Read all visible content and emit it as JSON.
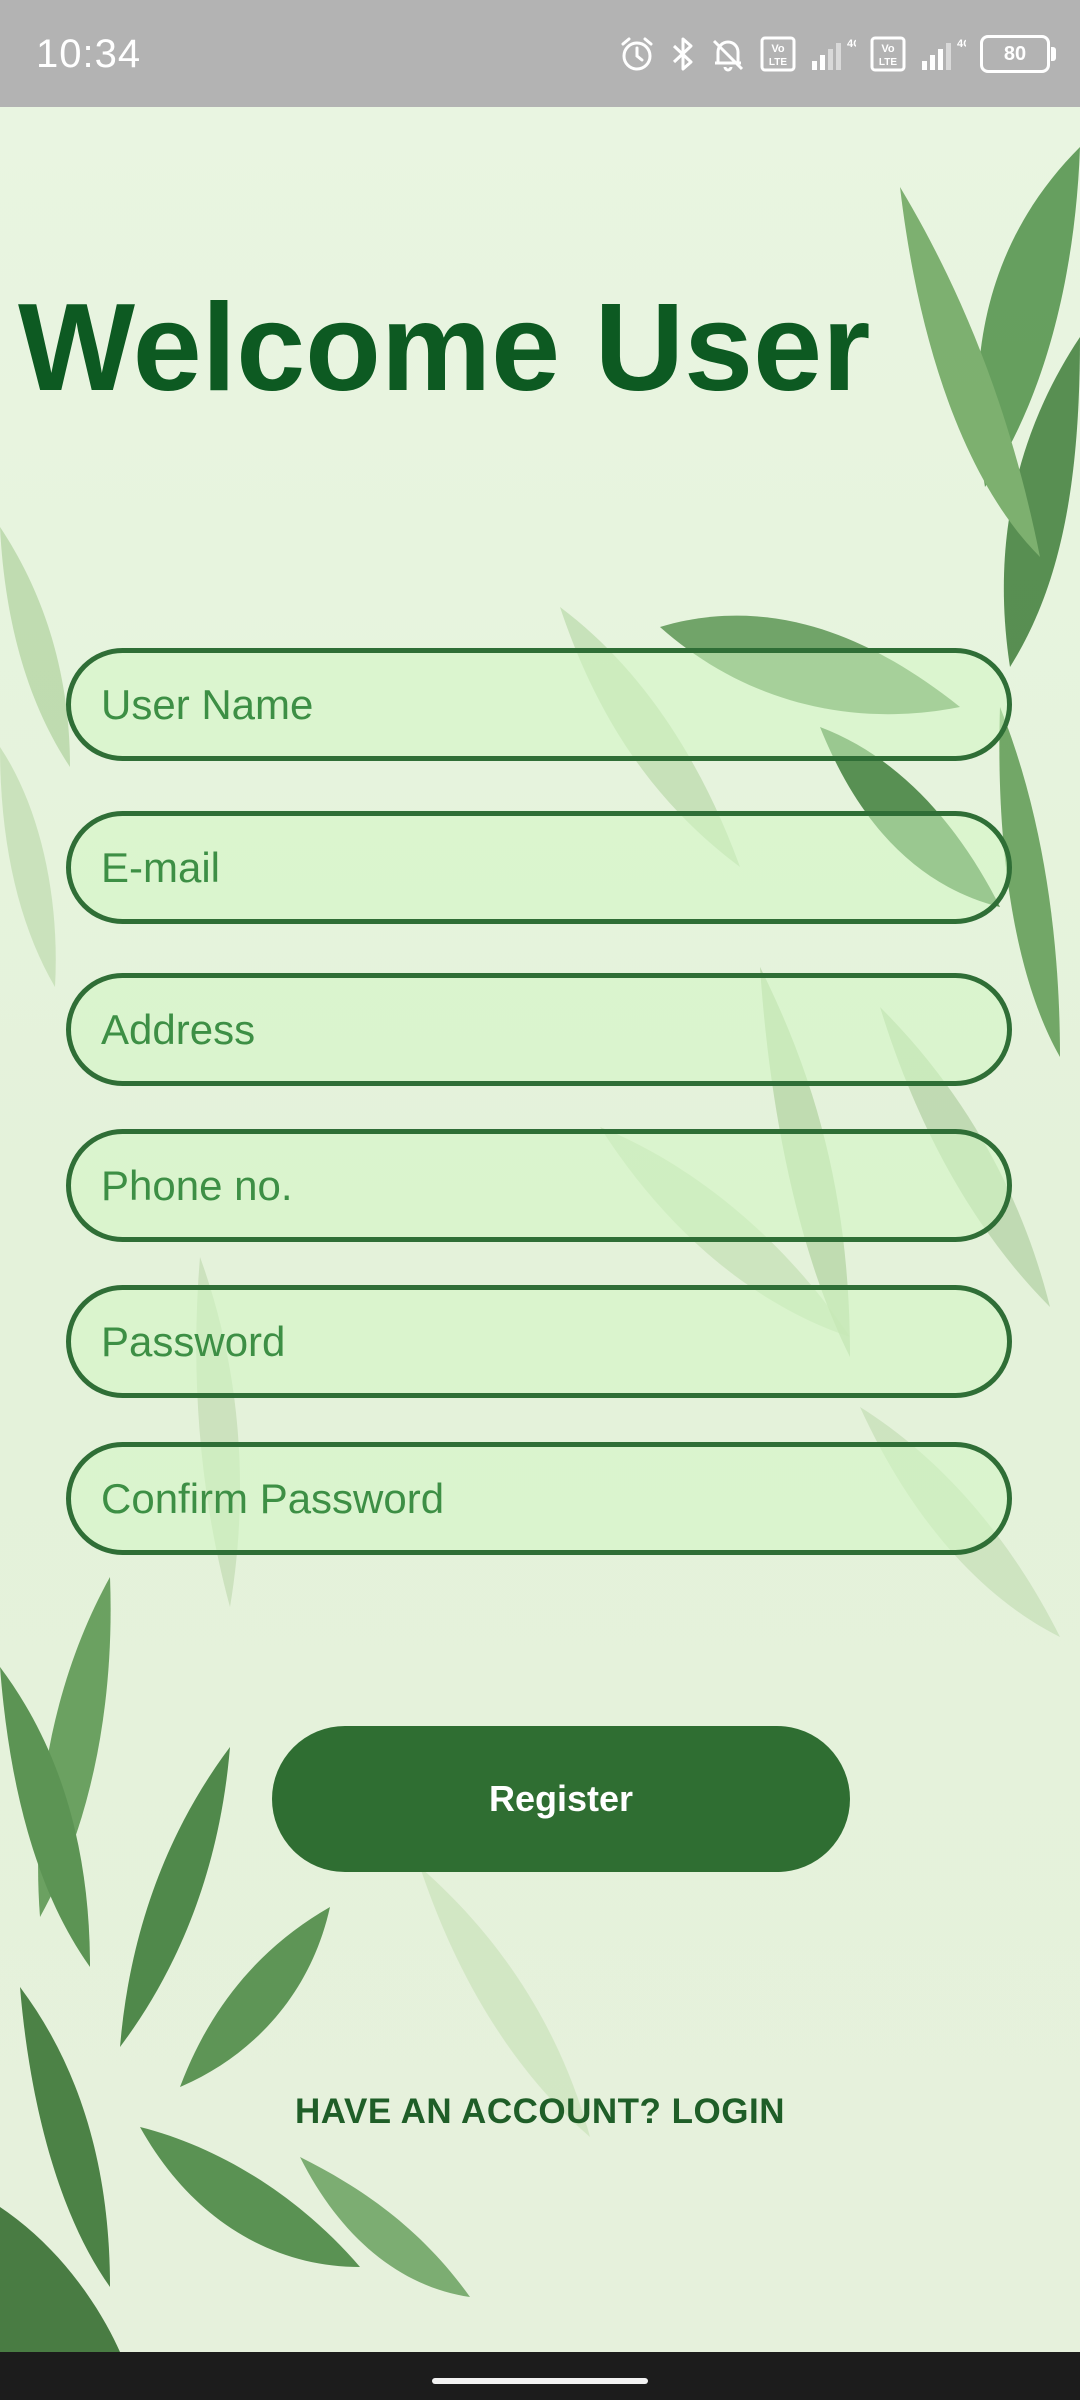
{
  "status_bar": {
    "time": "10:34",
    "battery": "80",
    "network_1": "4G",
    "network_2": "4G",
    "volte_1": "Vo LTE",
    "volte_2": "Vo LTE",
    "icons": [
      "alarm-icon",
      "bluetooth-icon",
      "bell-muted-icon",
      "volte-icon",
      "signal-icon",
      "volte-icon",
      "signal-icon",
      "battery-icon"
    ]
  },
  "screen": {
    "title": "Welcome User",
    "fields": {
      "username_placeholder": "User Name",
      "email_placeholder": "E-mail",
      "address_placeholder": "Address",
      "phone_placeholder": "Phone no.",
      "password_placeholder": "Password",
      "confirm_password_placeholder": "Confirm Password"
    },
    "register_label": "Register",
    "login_link": "HAVE AN ACCOUNT? LOGIN"
  },
  "colors": {
    "title": "#0d5a22",
    "field_border": "#2f6e36",
    "button": "#2f6e32",
    "background": "#e6f3dc",
    "status_bar": "#b3b3b3",
    "nav_bar": "#1c1c1c"
  }
}
